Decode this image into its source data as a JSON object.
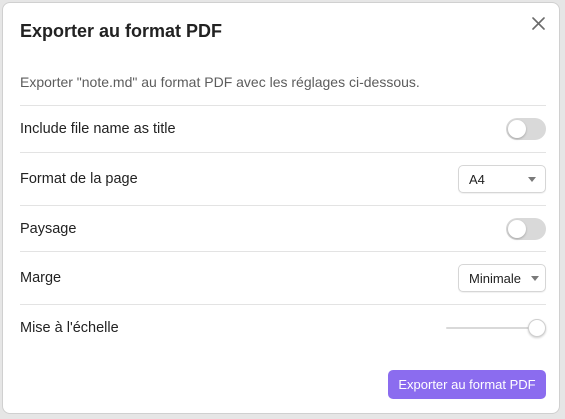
{
  "dialog": {
    "title": "Exporter au format PDF",
    "description": "Exporter \"note.md\" au format PDF avec les réglages ci-dessous.",
    "close_icon": "close-icon"
  },
  "settings": {
    "include_title": {
      "label": "Include file name as title",
      "enabled": false
    },
    "page_format": {
      "label": "Format de la page",
      "value": "A4"
    },
    "landscape": {
      "label": "Paysage",
      "enabled": false
    },
    "margin": {
      "label": "Marge",
      "value": "Minimale"
    },
    "scale": {
      "label": "Mise à l'échelle",
      "level": 1.0
    }
  },
  "actions": {
    "export_label": "Exporter au format PDF"
  },
  "colors": {
    "accent": "#8b6cef",
    "toggle_off": "#d9d9d9"
  }
}
